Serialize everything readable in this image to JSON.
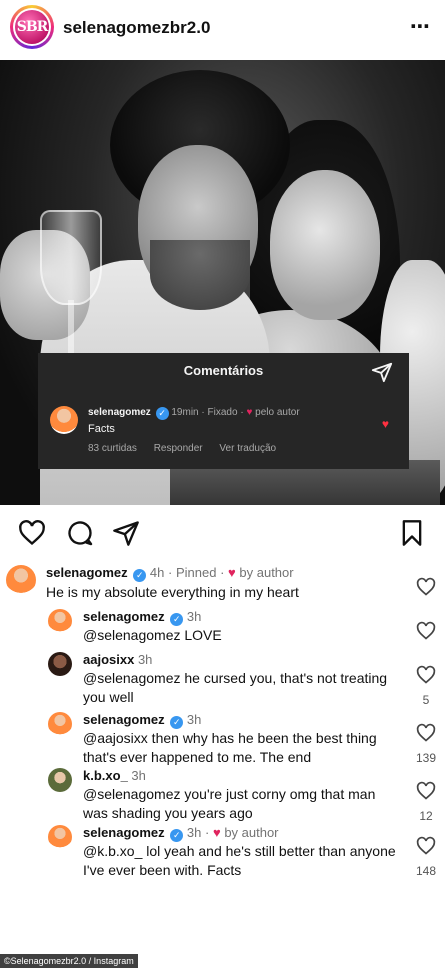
{
  "header": {
    "avatar_text": "SBR",
    "username": "selenagomezbr2.0",
    "more_icon": "⋯"
  },
  "overlay": {
    "title": "Comentários",
    "username": "selenagomez",
    "time": "19min",
    "pinned": "Fixado",
    "by_author": "pelo autor",
    "text": "Facts",
    "likes": "83 curtidas",
    "reply": "Responder",
    "translate": "Ver tradução"
  },
  "comments": [
    {
      "username": "selenagomez",
      "verified": true,
      "time": "4h",
      "pinned": "Pinned",
      "by_author": "by author",
      "text": "He is my absolute everything in my heart",
      "likes": ""
    },
    {
      "username": "selenagomez",
      "verified": true,
      "time": "3h",
      "text": "@selenagomez LOVE",
      "likes": ""
    },
    {
      "username": "aajosixx",
      "verified": false,
      "time": "3h",
      "text": "@selenagomez he cursed you, that's not treating you well",
      "likes": "5"
    },
    {
      "username": "selenagomez",
      "verified": true,
      "time": "3h",
      "text": "@aajosixx then why has he been the best thing that's ever happened to me. The end",
      "likes": "139"
    },
    {
      "username": "k.b.xo_",
      "verified": false,
      "time": "3h",
      "text": "@selenagomez you're just corny omg that man was shading you years ago",
      "likes": "12"
    },
    {
      "username": "selenagomez",
      "verified": true,
      "time": "3h",
      "by_author": "by author",
      "text": "@k.b.xo_ lol yeah and he's still better than anyone I've ever been with. Facts",
      "likes": "148"
    }
  ],
  "footer": "©Selenagomezbr2.0 / Instagram",
  "colors": {
    "verified": "#3897f0",
    "heart": "#e0245e",
    "panel": "#262626"
  }
}
